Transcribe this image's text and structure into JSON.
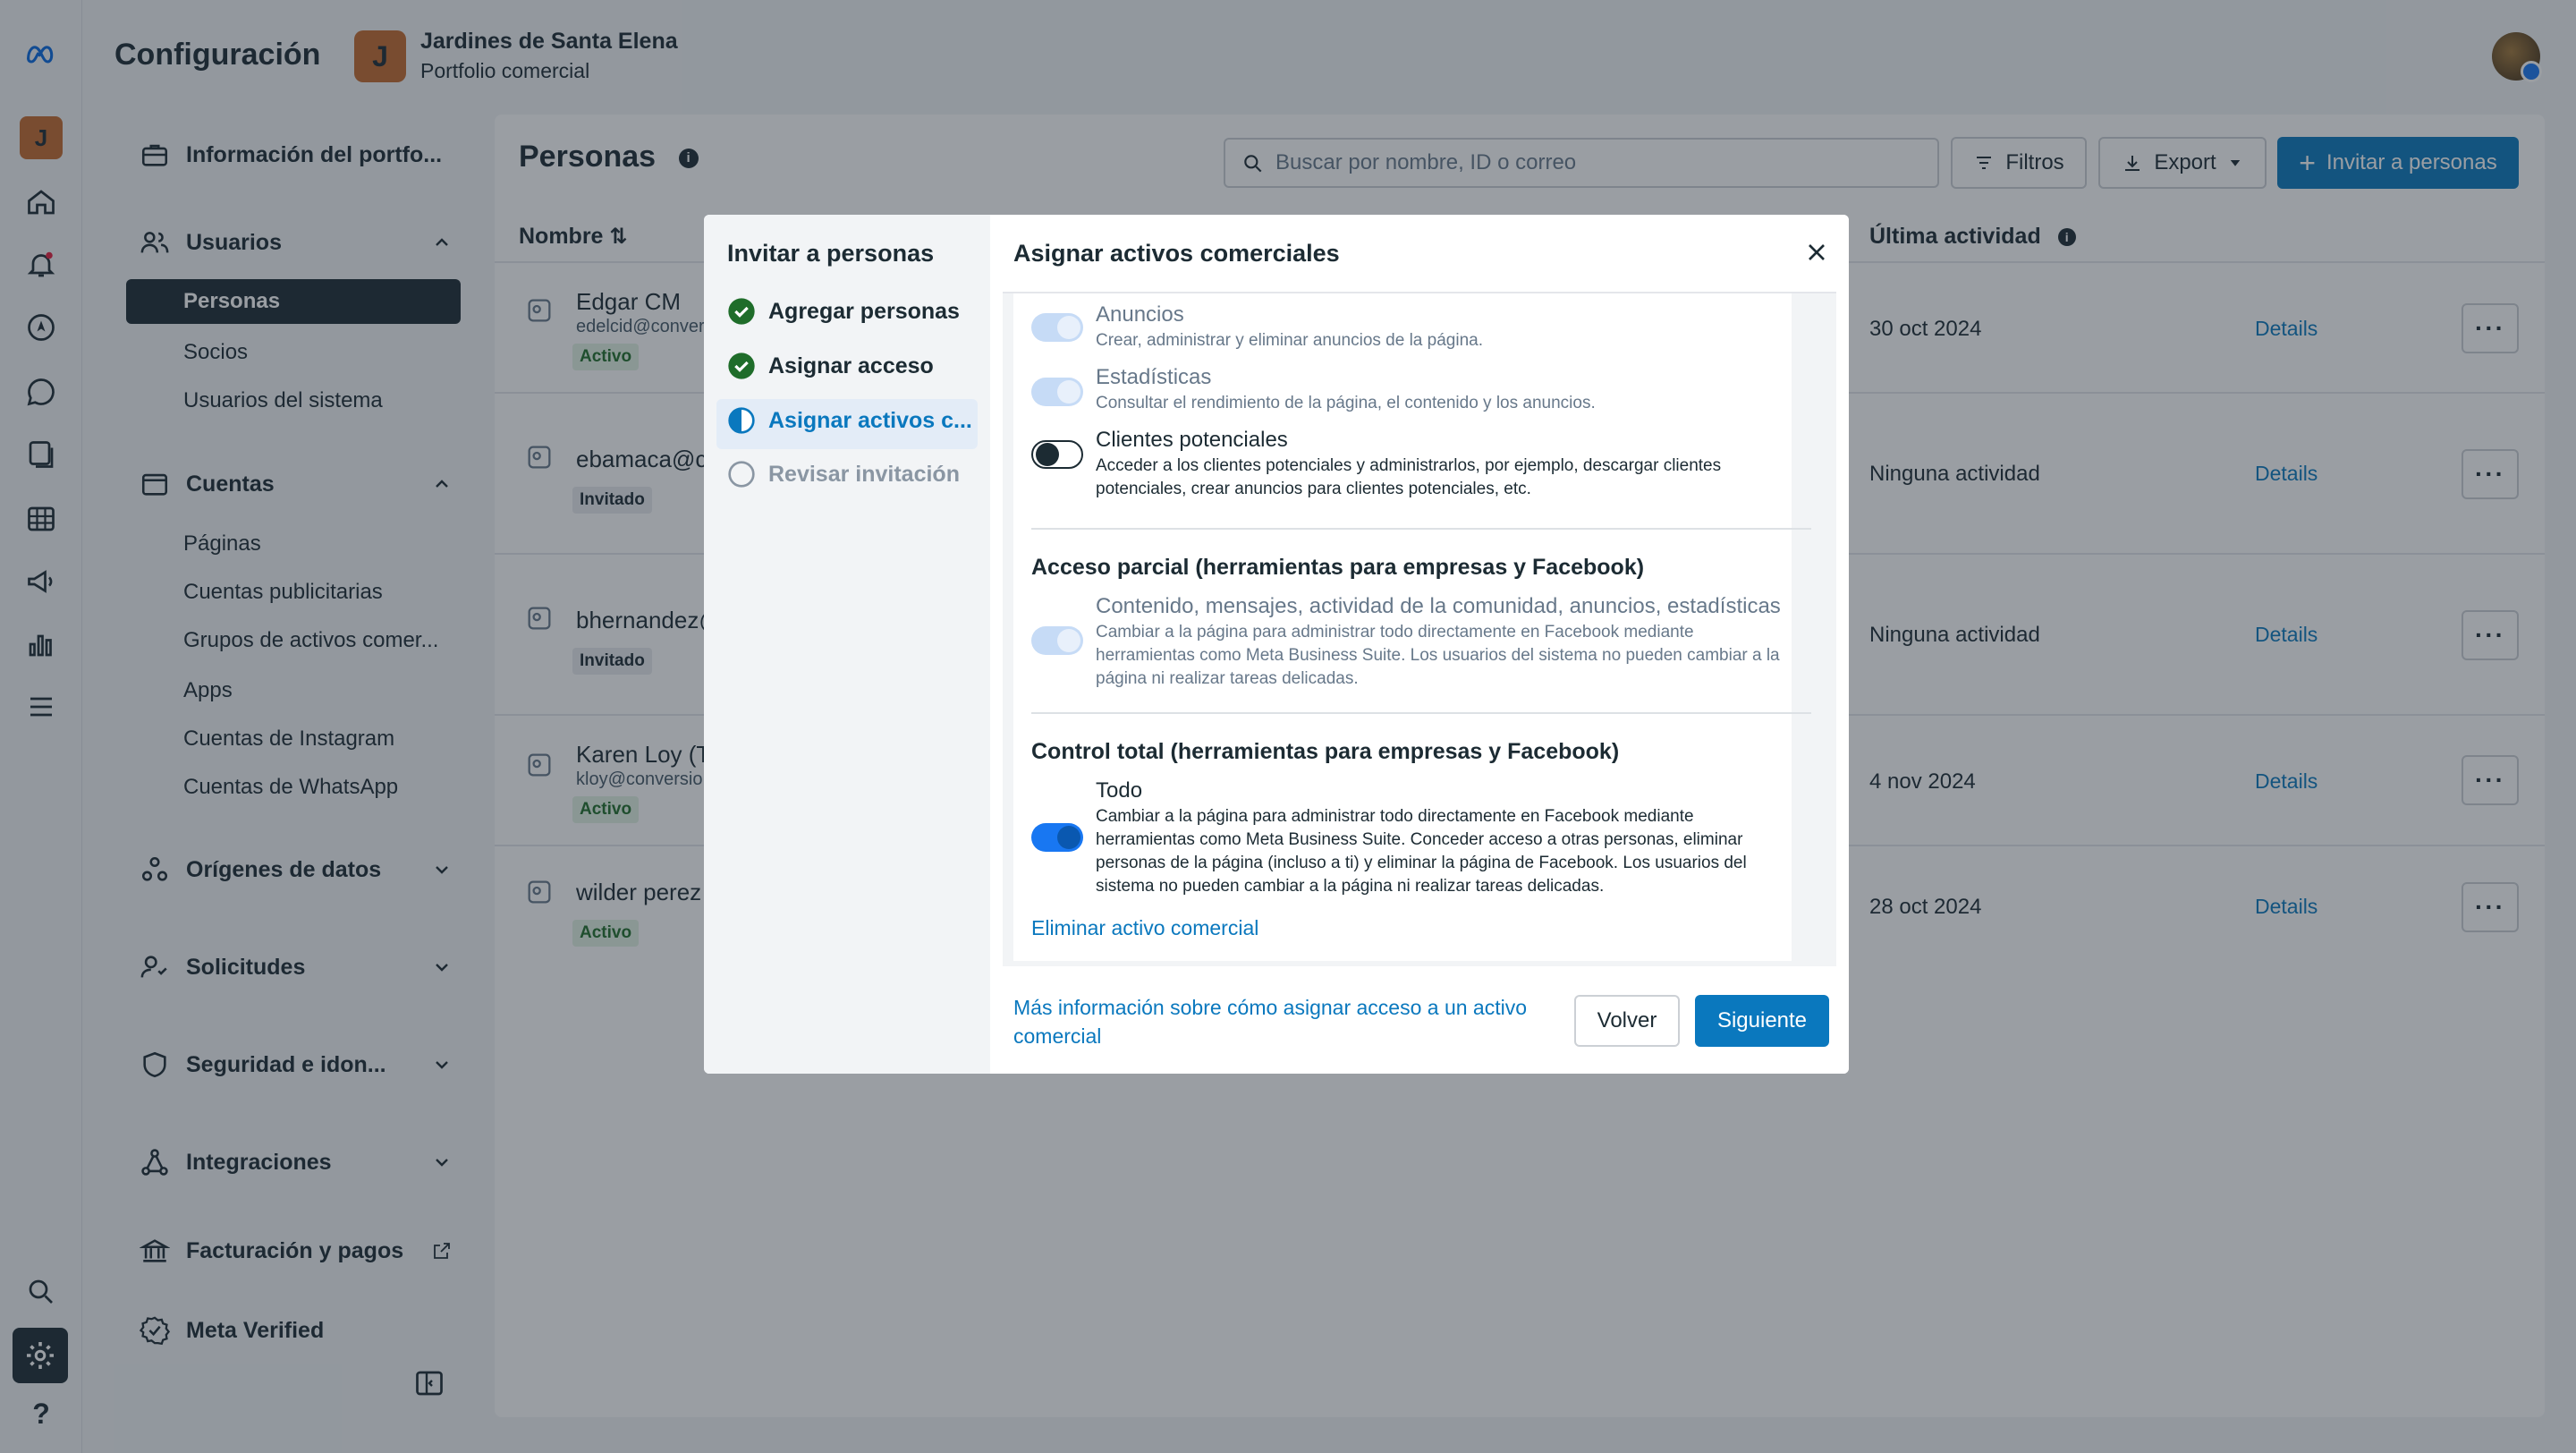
{
  "app": {
    "title": "Configuración"
  },
  "portfolio": {
    "initial": "J",
    "name": "Jardines de Santa Elena",
    "type": "Portfolio comercial"
  },
  "rail": {
    "portfolio_initial": "J",
    "help_label": "?"
  },
  "sidebar": {
    "info": "Información del portfo...",
    "users_group": "Usuarios",
    "users_items": [
      "Personas",
      "Socios",
      "Usuarios del sistema"
    ],
    "accounts_group": "Cuentas",
    "accounts_items": [
      "Páginas",
      "Cuentas publicitarias",
      "Grupos de activos comer...",
      "Apps",
      "Cuentas de Instagram",
      "Cuentas de WhatsApp"
    ],
    "data_sources": "Orígenes de datos",
    "requests": "Solicitudes",
    "security": "Seguridad e idon...",
    "integrations": "Integraciones",
    "billing": "Facturación y pagos",
    "verified": "Meta Verified"
  },
  "main": {
    "title": "Personas",
    "search_placeholder": "Buscar por nombre, ID o correo",
    "filters_label": "Filtros",
    "export_label": "Export",
    "invite_label": "Invitar a personas",
    "col_name": "Nombre",
    "col_activity": "Última actividad",
    "rows": [
      {
        "name": "Edgar CM",
        "email": "edelcid@conver",
        "status": "Activo",
        "date": "30 oct 2024",
        "details": "Details"
      },
      {
        "name": "ebamaca@c",
        "email": "",
        "status": "Invitado",
        "date": "Ninguna actividad",
        "details": "Details"
      },
      {
        "name": "bhernandez@",
        "email": "",
        "status": "Invitado",
        "date": "Ninguna actividad",
        "details": "Details"
      },
      {
        "name": "Karen Loy (T",
        "email": "kloy@conversio",
        "status": "Activo",
        "date": "4 nov 2024",
        "details": "Details"
      },
      {
        "name": "wilder perez",
        "email": "",
        "status": "Activo",
        "date": "28 oct 2024",
        "details": "Details"
      }
    ]
  },
  "modal": {
    "steps_title": "Invitar a personas",
    "steps": [
      {
        "label": "Agregar personas",
        "state": "done"
      },
      {
        "label": "Asignar acceso",
        "state": "done"
      },
      {
        "label": "Asignar activos c...",
        "state": "current"
      },
      {
        "label": "Revisar invitación",
        "state": "pending"
      }
    ],
    "title": "Asignar activos comerciales",
    "permissions": [
      {
        "title": "Anuncios",
        "desc": "Crear, administrar y eliminar anuncios de la página.",
        "enabled": true,
        "disabled": true
      },
      {
        "title": "Estadísticas",
        "desc": "Consultar el rendimiento de la página, el contenido y los anuncios.",
        "enabled": true,
        "disabled": true
      },
      {
        "title": "Clientes potenciales",
        "desc": "Acceder a los clientes potenciales y administrarlos, por ejemplo, descargar clientes potenciales, crear anuncios para clientes potenciales, etc.",
        "enabled": false,
        "disabled": false
      }
    ],
    "partial_title": "Acceso parcial (herramientas para empresas y Facebook)",
    "partial_item": {
      "title": "Contenido, mensajes, actividad de la comunidad, anuncios, estadísticas",
      "desc": "Cambiar a la página para administrar todo directamente en Facebook mediante herramientas como Meta Business Suite. Los usuarios del sistema no pueden cambiar a la página ni realizar tareas delicadas.",
      "enabled": true,
      "disabled": true
    },
    "full_title": "Control total (herramientas para empresas y Facebook)",
    "full_item": {
      "title": "Todo",
      "desc": "Cambiar a la página para administrar todo directamente en Facebook mediante herramientas como Meta Business Suite. Conceder acceso a otras personas, eliminar personas de la página (incluso a ti) y eliminar la página de Facebook. Los usuarios del sistema no pueden cambiar a la página ni realizar tareas delicadas.",
      "enabled": true,
      "disabled": false
    },
    "remove_link": "Eliminar activo comercial",
    "footer_link": "Más información sobre cómo asignar acceso a un activo comercial",
    "back_label": "Volver",
    "next_label": "Siguiente"
  },
  "colors": {
    "primary": "#0a78be",
    "dark": "#1c2b33",
    "success": "#1f6d2a",
    "toggle_on": "#1877f2"
  }
}
